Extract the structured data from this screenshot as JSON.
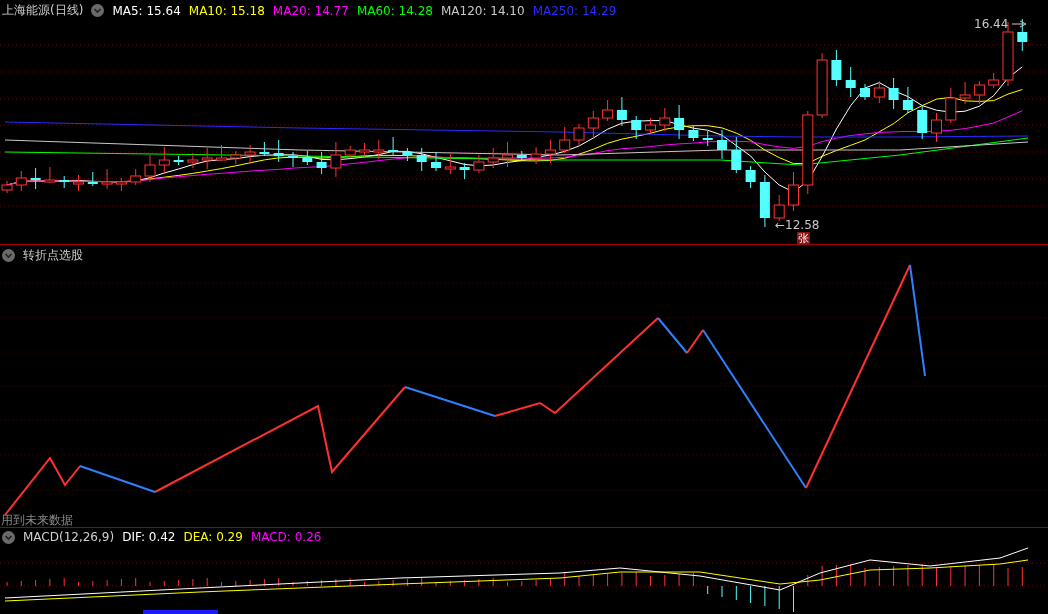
{
  "price_panel": {
    "title": "上海能源(日线)",
    "legend": [
      {
        "label": "MA5: 15.64",
        "color": "#ffffff"
      },
      {
        "label": "MA10: 15.18",
        "color": "#ffff00"
      },
      {
        "label": "MA20: 14.77",
        "color": "#ff00ff"
      },
      {
        "label": "MA60: 14.28",
        "color": "#00ff00"
      },
      {
        "label": "MA120: 14.10",
        "color": "#c8c8c8"
      },
      {
        "label": "MA250: 14.29",
        "color": "#2b2bff"
      }
    ],
    "high_label": "16.44",
    "low_label": "←12.58",
    "marker": "张"
  },
  "indicator_panel": {
    "title": "转折点选股",
    "note": "用到未来数据"
  },
  "macd_panel": {
    "title": "MACD(12,26,9)",
    "legend": [
      {
        "label": "DIF: 0.42",
        "color": "#ffffff"
      },
      {
        "label": "DEA: 0.29",
        "color": "#ffff00"
      },
      {
        "label": "MACD: 0.26",
        "color": "#ff00ff"
      }
    ]
  }
}
